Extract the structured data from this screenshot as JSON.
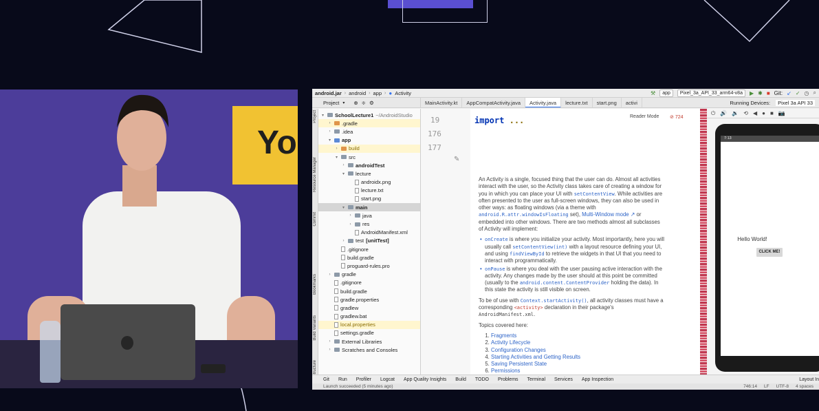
{
  "ide": {
    "breadcrumb": [
      "android.jar",
      "android",
      "app",
      "Activity"
    ],
    "run_config": "app",
    "device": "Pixel_3a_API_33_arm64-v8a",
    "vcs_label": "Git:",
    "project_label": "Project",
    "tabs": [
      "MainActivity.kt",
      "AppCompatActivity.java",
      "Activity.java",
      "lecture.txt",
      "start.png",
      "activi"
    ],
    "active_tab": "Activity.java",
    "running_devices_label": "Running Devices:",
    "running_device": "Pixel 3a API 33",
    "side_tools": [
      "Project",
      "Resource Manager",
      "Commit",
      "Bookmarks",
      "Build Variants",
      "Structure"
    ]
  },
  "tree": [
    {
      "label": "SchoolLecture1",
      "suffix": "~/AndroidStudio",
      "bold": true
    },
    {
      "label": ".gradle"
    },
    {
      "label": ".idea"
    },
    {
      "label": "app",
      "bold": true
    },
    {
      "label": "build"
    },
    {
      "label": "src"
    },
    {
      "label": "androidTest",
      "bold": true
    },
    {
      "label": "lecture"
    },
    {
      "label": "androidx.png"
    },
    {
      "label": "lecture.txt"
    },
    {
      "label": "start.png"
    },
    {
      "label": "main",
      "bold": true
    },
    {
      "label": "java"
    },
    {
      "label": "res"
    },
    {
      "label": "AndroidManifest.xml"
    },
    {
      "label": "test",
      "suffix": "[unitTest]",
      "bold": false
    },
    {
      "label": ".gitignore"
    },
    {
      "label": "build.gradle"
    },
    {
      "label": "proguard-rules.pro"
    },
    {
      "label": "gradle"
    },
    {
      "label": ".gitignore"
    },
    {
      "label": "build.gradle"
    },
    {
      "label": "gradle.properties"
    },
    {
      "label": "gradlew"
    },
    {
      "label": "gradlew.bat"
    },
    {
      "label": "local.properties"
    },
    {
      "label": "settings.gradle"
    },
    {
      "label": "External Libraries"
    },
    {
      "label": "Scratches and Consoles"
    }
  ],
  "editor": {
    "line_numbers": [
      "19",
      "176",
      "177"
    ],
    "import_keyword": "import",
    "import_dots": "...",
    "reader_mode": "Reader Mode",
    "warning_count": "724",
    "doc": {
      "p1_a": "An Activity is a single, focused thing that the user can do. Almost all activities interact with the user, so the Activity class takes care of creating a window for you in which you can place your UI with",
      "p1_code1": "setContentView",
      "p1_b": ". While activities are often presented to the user as full-screen windows, they can also be used in other ways: as floating windows (via a theme with",
      "p1_code2": "android.R.attr.windowIsFloating",
      "p1_c": "set),",
      "p1_link": "Multi-Window mode ↗",
      "p1_d": "or embedded into other windows. There are two methods almost all subclasses of Activity will implement:",
      "b1_code": "onCreate",
      "b1_a": "is where you initialize your activity. Most importantly, here you will usually call",
      "b1_code2": "setContentView(int)",
      "b1_b": "with a layout resource defining your UI, and using",
      "b1_code3": "findViewById",
      "b1_c": "to retrieve the widgets in that UI that you need to interact with programmatically.",
      "b2_code": "onPause",
      "b2_a": "is where you deal with the user pausing active interaction with the activity. Any changes made by the user should at this point be committed (usually to the",
      "b2_code2": "android.content.ContentProvider",
      "b2_b": "holding the data). In this state the activity is still visible on screen.",
      "p2_a": "To be of use with",
      "p2_code": "Context.startActivity()",
      "p2_b": ", all activity classes must have a corresponding",
      "p2_code2": "<activity>",
      "p2_c": "declaration in their package's",
      "p2_code3": "AndroidManifest.xml",
      "p2_d": ".",
      "topics_label": "Topics covered here:",
      "topics": [
        "Fragments",
        "Activity Lifecycle",
        "Configuration Changes",
        "Starting Activities and Getting Results",
        "Saving Persistent State",
        "Permissions"
      ]
    }
  },
  "emulator": {
    "status_time": "7:13",
    "hello_text": "Hello World!",
    "button_label": "CLICK ME!"
  },
  "bottom_tools": [
    "Git",
    "Run",
    "Profiler",
    "Logcat",
    "App Quality Insights",
    "Build",
    "TODO",
    "Problems",
    "Terminal",
    "Services",
    "App Inspection",
    "Layout In"
  ],
  "statusbar": {
    "message": "Launch succeeded (5 minutes ago)",
    "position": "746:14",
    "line_sep": "LF",
    "encoding": "UTF-8",
    "indent": "4 spaces"
  },
  "camera": {
    "banner_text": "Yo"
  }
}
